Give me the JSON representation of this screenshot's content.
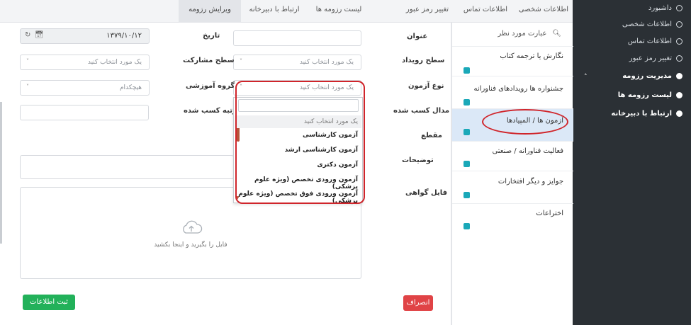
{
  "sidebar": {
    "items": [
      {
        "label": "داشبورد"
      },
      {
        "label": "اطلاعات شخصی"
      },
      {
        "label": "اطلاعات تماس"
      },
      {
        "label": "تغییر رمز عبور"
      },
      {
        "label": "مدیریت رزومه"
      },
      {
        "label": "لیست رزومه ها"
      },
      {
        "label": "ارتباط با دبیرخانه"
      }
    ]
  },
  "tabs": [
    {
      "label": "اطلاعات شخصی"
    },
    {
      "label": "اطلاعات تماس"
    },
    {
      "label": "تغییر رمز عبور"
    },
    {
      "label": "لیست رزومه ها"
    },
    {
      "label": "ارتباط با دبیرخانه"
    },
    {
      "label": "ویرایش رزومه"
    }
  ],
  "categories": {
    "search_placeholder": "عبارت مورد نظر",
    "items": [
      {
        "label": "نگارش یا ترجمه کتاب"
      },
      {
        "label": "جشنواره ها رویدادهای فناورانه"
      },
      {
        "label": "آزمون ها / المپیادها"
      },
      {
        "label": "فعالیت فناورانه / صنعتی"
      },
      {
        "label": "جوایز و دیگر افتخارات"
      },
      {
        "label": "اختراعات"
      }
    ]
  },
  "form": {
    "title_label": "عنوان",
    "date_label": "تاریخ",
    "date_value": "۱۳۷۹/۱۰/۱۲",
    "event_level_label": "سطح رویداد",
    "event_level_placeholder": "یک مورد انتخاب کنید",
    "participation_level_label": "سطح مشارکت",
    "participation_level_placeholder": "یک مورد انتخاب کنید",
    "exam_type_label": "نوع آزمون",
    "exam_type_placeholder": "یک مورد انتخاب کنید",
    "edu_group_label": "گروه آموزشی",
    "edu_group_value": "هیچکدام",
    "medal_label": "مدال کسب شده",
    "rank_label": "رتبه کسب شده",
    "section_label": "مقطع",
    "description_label": "توضیحات",
    "certificate_label": "فایل گواهی",
    "upload_text": "فایل را بگیرید و اینجا بکشید",
    "cancel_label": "انصراف",
    "submit_label": "ثبت اطلاعات"
  },
  "dropdown": {
    "options": [
      {
        "label": "یک مورد انتخاب کنید"
      },
      {
        "label": "آزمون کارشناسی"
      },
      {
        "label": "آزمون کارشناسی ارشد"
      },
      {
        "label": "آزمون دکتری"
      },
      {
        "label": "آزمون ورودی تخصص (ویژه علوم پزشکی)"
      },
      {
        "label": "آزمون ورودی فوق تخصص (ویژه علوم پزشکی)"
      }
    ]
  },
  "colors": {
    "sidebar_bg": "#2b3035",
    "accent_teal": "#1aa8b8",
    "highlight_red": "#d0252b",
    "cancel_red": "#e04346",
    "submit_green": "#22b15a"
  }
}
